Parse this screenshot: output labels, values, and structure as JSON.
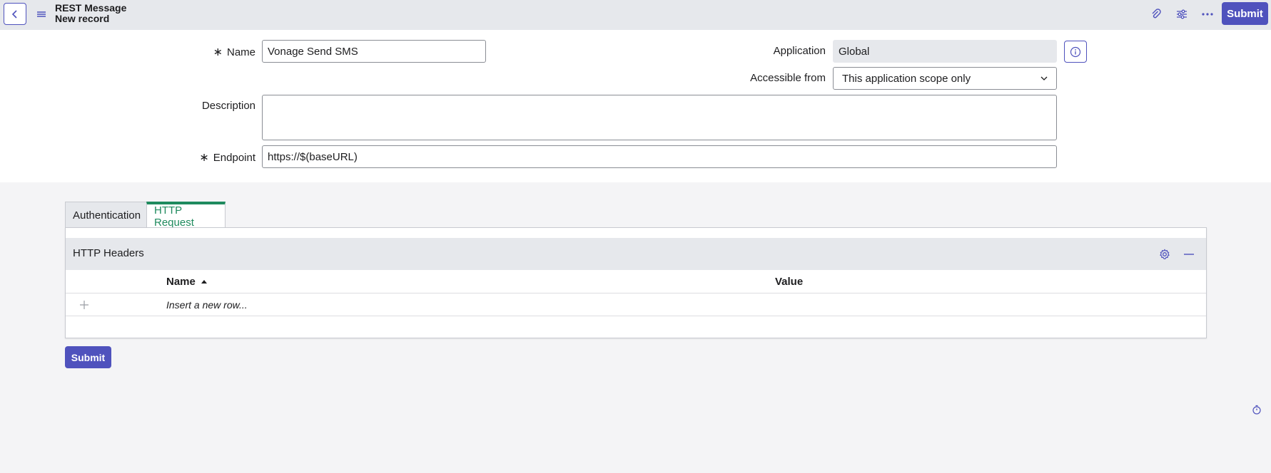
{
  "header": {
    "title": "REST Message",
    "subtitle": "New record",
    "submit_label": "Submit",
    "icons": [
      "back-icon",
      "menu-icon",
      "paperclip-icon",
      "sliders-icon",
      "more-icon"
    ]
  },
  "form": {
    "name_label": "Name",
    "name_value": "Vonage Send SMS",
    "application_label": "Application",
    "application_value": "Global",
    "accessible_label": "Accessible from",
    "accessible_value": "This application scope only",
    "description_label": "Description",
    "description_value": "",
    "endpoint_label": "Endpoint",
    "endpoint_value": "https://$(baseURL)",
    "required_marker": "∗"
  },
  "tabs": [
    {
      "label": "Authentication",
      "active": false
    },
    {
      "label": "HTTP Request",
      "active": true
    }
  ],
  "headers_panel": {
    "title": "HTTP Headers",
    "columns": [
      {
        "label": "Name",
        "sort": "ascending"
      },
      {
        "label": "Value"
      }
    ],
    "insert_row_text": "Insert a new row..."
  },
  "bottom": {
    "submit_label": "Submit"
  },
  "colors": {
    "primary": "#4f52bd",
    "active_tab": "#1f8a5e",
    "header_bg": "#e6e8ec"
  }
}
